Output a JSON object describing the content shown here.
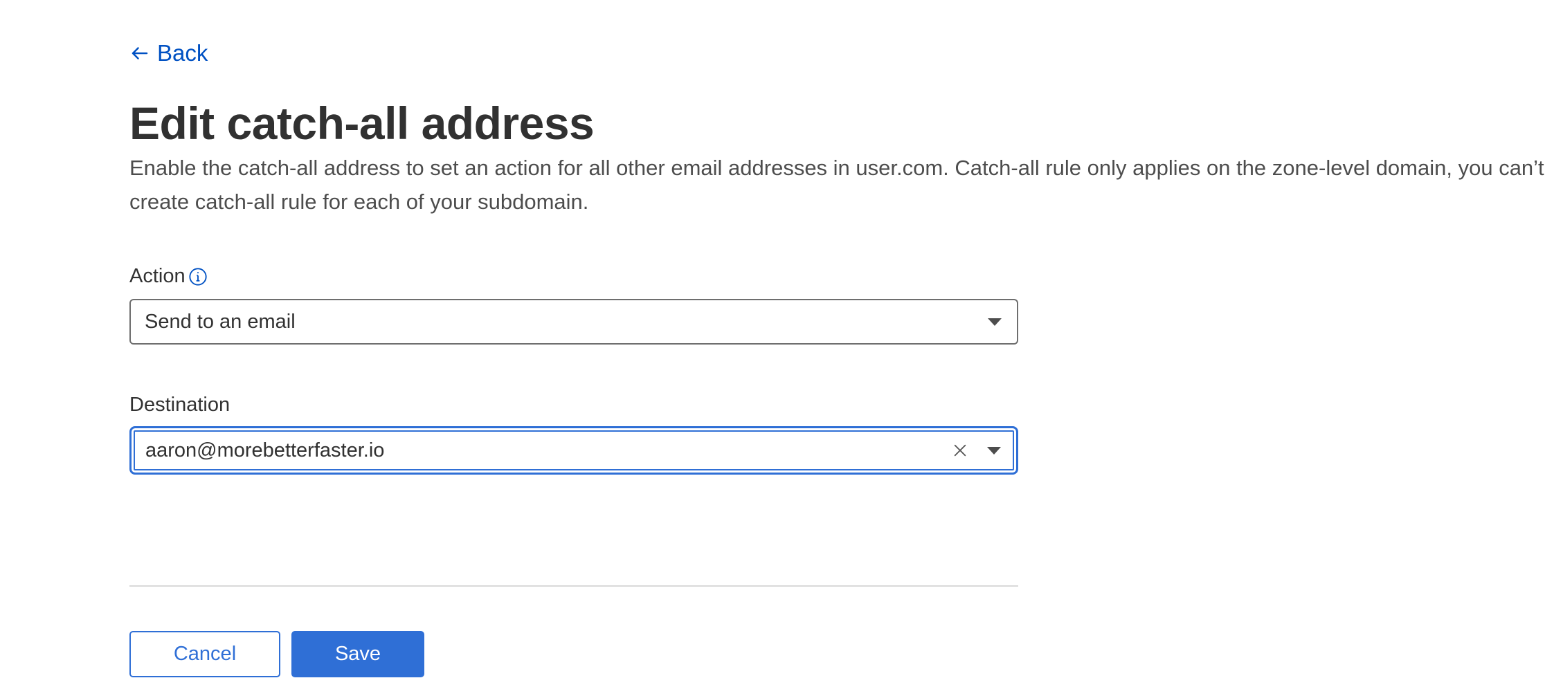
{
  "nav": {
    "back_label": "Back"
  },
  "header": {
    "title": "Edit catch-all address",
    "description": "Enable the catch-all address to set an action for all other email addresses in user.com. Catch-all rule only applies on the zone-level domain, you can’t create catch-all rule for each of your subdomain."
  },
  "form": {
    "action": {
      "label": "Action",
      "info_icon": "info-icon",
      "selected_value": "Send to an email"
    },
    "destination": {
      "label": "Destination",
      "selected_value": "aaron@morebetterfaster.io",
      "focused": true
    }
  },
  "buttons": {
    "cancel_label": "Cancel",
    "save_label": "Save"
  },
  "colors": {
    "link": "#0051c3",
    "primary": "#2f6fd6",
    "text": "#313131",
    "muted_text": "#4d4d4d",
    "divider": "#d9d9d9"
  }
}
